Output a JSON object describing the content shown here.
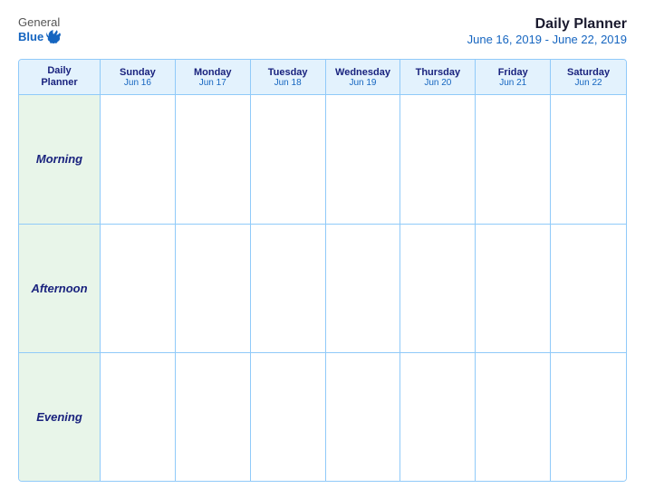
{
  "header": {
    "logo": {
      "general": "General",
      "blue": "Blue"
    },
    "title": "Daily Planner",
    "subtitle": "June 16, 2019 - June 22, 2019"
  },
  "calendar": {
    "header": {
      "col0": {
        "line1": "Daily",
        "line2": "Planner"
      },
      "cols": [
        {
          "day": "Sunday",
          "date": "Jun 16"
        },
        {
          "day": "Monday",
          "date": "Jun 17"
        },
        {
          "day": "Tuesday",
          "date": "Jun 18"
        },
        {
          "day": "Wednesday",
          "date": "Jun 19"
        },
        {
          "day": "Thursday",
          "date": "Jun 20"
        },
        {
          "day": "Friday",
          "date": "Jun 21"
        },
        {
          "day": "Saturday",
          "date": "Jun 22"
        }
      ]
    },
    "rows": [
      {
        "label": "Morning"
      },
      {
        "label": "Afternoon"
      },
      {
        "label": "Evening"
      }
    ]
  }
}
